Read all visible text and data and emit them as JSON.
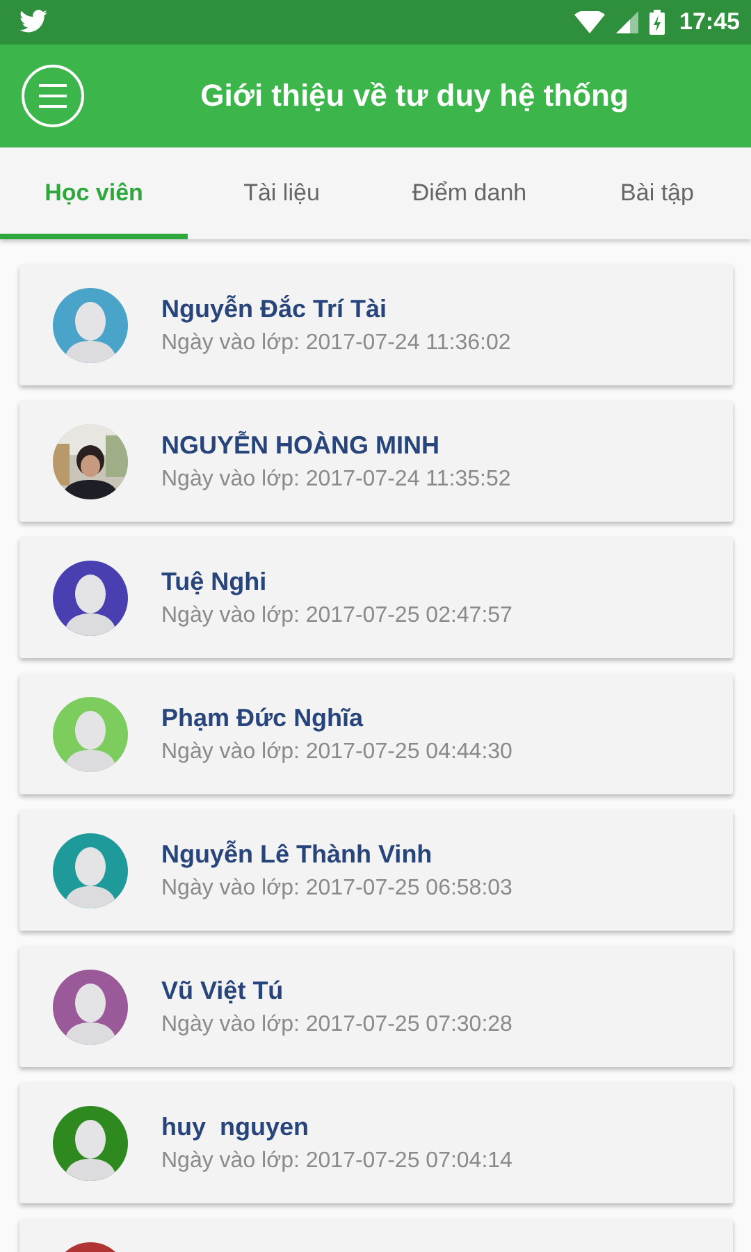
{
  "status_bar": {
    "time": "17:45"
  },
  "app_bar": {
    "title": "Giới thiệu về tư duy hệ thống"
  },
  "tabs": [
    {
      "label": "Học viên",
      "selected": true
    },
    {
      "label": "Tài liệu",
      "selected": false
    },
    {
      "label": "Điểm danh",
      "selected": false
    },
    {
      "label": "Bài tập",
      "selected": false
    }
  ],
  "students": [
    {
      "name": "Nguyễn Đắc Trí Tài",
      "joined": "Ngày vào lớp: 2017-07-24 11:36:02",
      "avatar": {
        "kind": "silhouette",
        "color": "#4aa3c8"
      }
    },
    {
      "name": "NGUYỄN HOÀNG MINH",
      "joined": "Ngày vào lớp: 2017-07-24 11:35:52"
    },
    {
      "name": "Tuệ Nghi",
      "joined": "Ngày vào lớp: 2017-07-25 02:47:57",
      "avatar": {
        "kind": "silhouette",
        "color": "#4a3fb0"
      }
    },
    {
      "name": "Phạm Đức Nghĩa",
      "joined": "Ngày vào lớp: 2017-07-25 04:44:30",
      "avatar": {
        "kind": "silhouette",
        "color": "#7ccc5e"
      }
    },
    {
      "name": "Nguyễn Lê Thành Vinh",
      "joined": "Ngày vào lớp: 2017-07-25 06:58:03",
      "avatar": {
        "kind": "silhouette",
        "color": "#1e9a9a"
      }
    },
    {
      "name": "Vũ Việt Tú",
      "joined": "Ngày vào lớp: 2017-07-25 07:30:28",
      "avatar": {
        "kind": "silhouette",
        "color": "#9a5a9a"
      }
    },
    {
      "name": "huy  nguyen",
      "joined": "Ngày vào lớp: 2017-07-25 07:04:14",
      "avatar": {
        "kind": "silhouette",
        "color": "#2e8a1e"
      }
    },
    {
      "avatar": {
        "kind": "silhouette",
        "color": "#b03434"
      }
    }
  ]
}
